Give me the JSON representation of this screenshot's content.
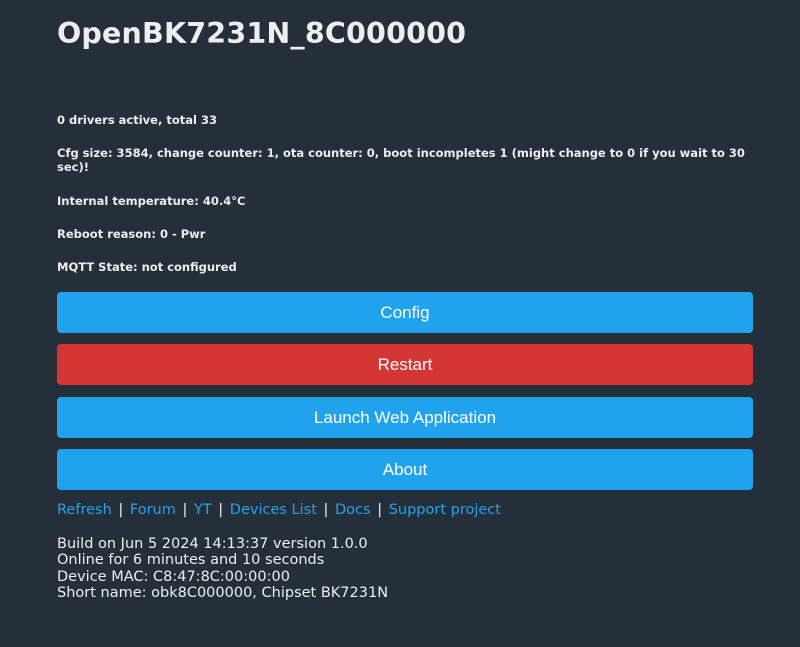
{
  "page": {
    "title": "OpenBK7231N_8C000000"
  },
  "status": {
    "drivers": "0 drivers active, total 33",
    "cfg": "Cfg size: 3584, change counter: 1, ota counter: 0, boot incompletes 1 (might change to 0 if you wait to 30 sec)!",
    "temperature": "Internal temperature: 40.4°C",
    "reboot": "Reboot reason: 0 - Pwr",
    "mqtt": "MQTT State: not configured"
  },
  "buttons": {
    "config": "Config",
    "restart": "Restart",
    "launch": "Launch Web Application",
    "about": "About"
  },
  "links": {
    "refresh": "Refresh",
    "forum": "Forum",
    "yt": "YT",
    "devices": "Devices List",
    "docs": "Docs",
    "support": "Support project",
    "separator": "|"
  },
  "footer": {
    "build": "Build on Jun 5 2024 14:13:37 version 1.0.0",
    "online": "Online for 6 minutes and 10 seconds",
    "mac": "Device MAC: C8:47:8C:00:00:00",
    "shortname": "Short name: obk8C000000, Chipset BK7231N"
  },
  "colors": {
    "background": "#252f3a",
    "primary_button": "#1fa3ec",
    "danger_button": "#d43535",
    "link": "#1fa3ec",
    "text": "#eeeeee"
  }
}
